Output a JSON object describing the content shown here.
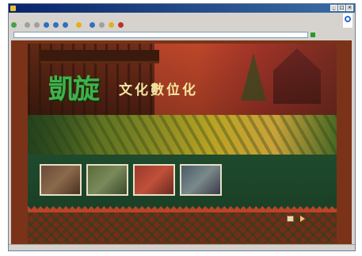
{
  "window": {
    "title": ""
  },
  "menubar": {
    "items": []
  },
  "toolbar": {
    "back_label": "",
    "search_label": "",
    "favorites_label": ""
  },
  "addressbar": {
    "label": "",
    "url": "",
    "go_label": ""
  },
  "banner": {
    "logo_text": "凱旋",
    "subtitle": "",
    "title": "文化數位化",
    "tagline": ""
  },
  "photos": [
    {
      "name": "photo-1"
    },
    {
      "name": "photo-2"
    },
    {
      "name": "photo-3"
    },
    {
      "name": "photo-4"
    }
  ],
  "enter": {
    "label": ""
  },
  "icons": {
    "app": "ie-page-icon",
    "minimize": "minimize-icon",
    "maximize": "maximize-icon",
    "close": "close-icon",
    "back": "back-arrow-icon",
    "forward": "forward-arrow-icon",
    "stop": "stop-icon",
    "refresh": "refresh-icon",
    "home": "home-icon",
    "search": "search-icon",
    "favorites": "star-icon",
    "media": "media-icon",
    "history": "history-icon",
    "mail": "mail-icon",
    "print": "print-icon",
    "go": "go-arrow-icon",
    "enter": "enter-arrow-icon"
  },
  "colors": {
    "titlebar": "#0a246a",
    "page_background": "#7a3318",
    "logo_green": "#3fb24a",
    "title_gold": "#f6e7a0",
    "forest_band": "#1a4026"
  }
}
